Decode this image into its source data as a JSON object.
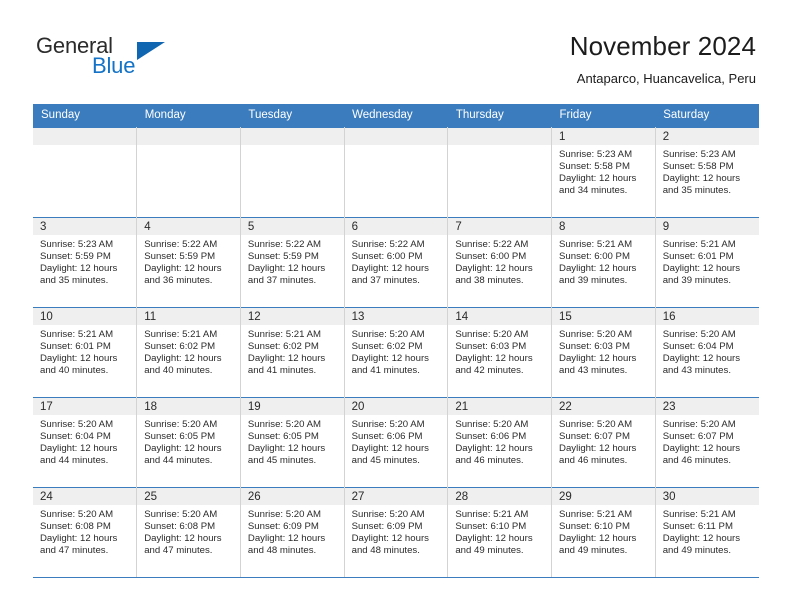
{
  "brand": {
    "name_part1": "General",
    "name_part2": "Blue",
    "colors": {
      "accent": "#1473c6",
      "triangle": "#1066b0",
      "header_blue": "#3a7cbe",
      "daynum_band": "#efefef"
    }
  },
  "header": {
    "title": "November 2024",
    "subtitle": "Antaparco, Huancavelica, Peru"
  },
  "weekdays": [
    "Sunday",
    "Monday",
    "Tuesday",
    "Wednesday",
    "Thursday",
    "Friday",
    "Saturday"
  ],
  "labels": {
    "sunrise_prefix": "Sunrise:",
    "sunset_prefix": "Sunset:",
    "daylight_prefix": "Daylight:"
  },
  "weeks": [
    [
      {
        "day": "",
        "empty": true
      },
      {
        "day": "",
        "empty": true
      },
      {
        "day": "",
        "empty": true
      },
      {
        "day": "",
        "empty": true
      },
      {
        "day": "",
        "empty": true
      },
      {
        "day": "1",
        "sunrise": "Sunrise: 5:23 AM",
        "sunset": "Sunset: 5:58 PM",
        "daylight_l1": "Daylight: 12 hours",
        "daylight_l2": "and 34 minutes."
      },
      {
        "day": "2",
        "sunrise": "Sunrise: 5:23 AM",
        "sunset": "Sunset: 5:58 PM",
        "daylight_l1": "Daylight: 12 hours",
        "daylight_l2": "and 35 minutes."
      }
    ],
    [
      {
        "day": "3",
        "sunrise": "Sunrise: 5:23 AM",
        "sunset": "Sunset: 5:59 PM",
        "daylight_l1": "Daylight: 12 hours",
        "daylight_l2": "and 35 minutes."
      },
      {
        "day": "4",
        "sunrise": "Sunrise: 5:22 AM",
        "sunset": "Sunset: 5:59 PM",
        "daylight_l1": "Daylight: 12 hours",
        "daylight_l2": "and 36 minutes."
      },
      {
        "day": "5",
        "sunrise": "Sunrise: 5:22 AM",
        "sunset": "Sunset: 5:59 PM",
        "daylight_l1": "Daylight: 12 hours",
        "daylight_l2": "and 37 minutes."
      },
      {
        "day": "6",
        "sunrise": "Sunrise: 5:22 AM",
        "sunset": "Sunset: 6:00 PM",
        "daylight_l1": "Daylight: 12 hours",
        "daylight_l2": "and 37 minutes."
      },
      {
        "day": "7",
        "sunrise": "Sunrise: 5:22 AM",
        "sunset": "Sunset: 6:00 PM",
        "daylight_l1": "Daylight: 12 hours",
        "daylight_l2": "and 38 minutes."
      },
      {
        "day": "8",
        "sunrise": "Sunrise: 5:21 AM",
        "sunset": "Sunset: 6:00 PM",
        "daylight_l1": "Daylight: 12 hours",
        "daylight_l2": "and 39 minutes."
      },
      {
        "day": "9",
        "sunrise": "Sunrise: 5:21 AM",
        "sunset": "Sunset: 6:01 PM",
        "daylight_l1": "Daylight: 12 hours",
        "daylight_l2": "and 39 minutes."
      }
    ],
    [
      {
        "day": "10",
        "sunrise": "Sunrise: 5:21 AM",
        "sunset": "Sunset: 6:01 PM",
        "daylight_l1": "Daylight: 12 hours",
        "daylight_l2": "and 40 minutes."
      },
      {
        "day": "11",
        "sunrise": "Sunrise: 5:21 AM",
        "sunset": "Sunset: 6:02 PM",
        "daylight_l1": "Daylight: 12 hours",
        "daylight_l2": "and 40 minutes."
      },
      {
        "day": "12",
        "sunrise": "Sunrise: 5:21 AM",
        "sunset": "Sunset: 6:02 PM",
        "daylight_l1": "Daylight: 12 hours",
        "daylight_l2": "and 41 minutes."
      },
      {
        "day": "13",
        "sunrise": "Sunrise: 5:20 AM",
        "sunset": "Sunset: 6:02 PM",
        "daylight_l1": "Daylight: 12 hours",
        "daylight_l2": "and 41 minutes."
      },
      {
        "day": "14",
        "sunrise": "Sunrise: 5:20 AM",
        "sunset": "Sunset: 6:03 PM",
        "daylight_l1": "Daylight: 12 hours",
        "daylight_l2": "and 42 minutes."
      },
      {
        "day": "15",
        "sunrise": "Sunrise: 5:20 AM",
        "sunset": "Sunset: 6:03 PM",
        "daylight_l1": "Daylight: 12 hours",
        "daylight_l2": "and 43 minutes."
      },
      {
        "day": "16",
        "sunrise": "Sunrise: 5:20 AM",
        "sunset": "Sunset: 6:04 PM",
        "daylight_l1": "Daylight: 12 hours",
        "daylight_l2": "and 43 minutes."
      }
    ],
    [
      {
        "day": "17",
        "sunrise": "Sunrise: 5:20 AM",
        "sunset": "Sunset: 6:04 PM",
        "daylight_l1": "Daylight: 12 hours",
        "daylight_l2": "and 44 minutes."
      },
      {
        "day": "18",
        "sunrise": "Sunrise: 5:20 AM",
        "sunset": "Sunset: 6:05 PM",
        "daylight_l1": "Daylight: 12 hours",
        "daylight_l2": "and 44 minutes."
      },
      {
        "day": "19",
        "sunrise": "Sunrise: 5:20 AM",
        "sunset": "Sunset: 6:05 PM",
        "daylight_l1": "Daylight: 12 hours",
        "daylight_l2": "and 45 minutes."
      },
      {
        "day": "20",
        "sunrise": "Sunrise: 5:20 AM",
        "sunset": "Sunset: 6:06 PM",
        "daylight_l1": "Daylight: 12 hours",
        "daylight_l2": "and 45 minutes."
      },
      {
        "day": "21",
        "sunrise": "Sunrise: 5:20 AM",
        "sunset": "Sunset: 6:06 PM",
        "daylight_l1": "Daylight: 12 hours",
        "daylight_l2": "and 46 minutes."
      },
      {
        "day": "22",
        "sunrise": "Sunrise: 5:20 AM",
        "sunset": "Sunset: 6:07 PM",
        "daylight_l1": "Daylight: 12 hours",
        "daylight_l2": "and 46 minutes."
      },
      {
        "day": "23",
        "sunrise": "Sunrise: 5:20 AM",
        "sunset": "Sunset: 6:07 PM",
        "daylight_l1": "Daylight: 12 hours",
        "daylight_l2": "and 46 minutes."
      }
    ],
    [
      {
        "day": "24",
        "sunrise": "Sunrise: 5:20 AM",
        "sunset": "Sunset: 6:08 PM",
        "daylight_l1": "Daylight: 12 hours",
        "daylight_l2": "and 47 minutes."
      },
      {
        "day": "25",
        "sunrise": "Sunrise: 5:20 AM",
        "sunset": "Sunset: 6:08 PM",
        "daylight_l1": "Daylight: 12 hours",
        "daylight_l2": "and 47 minutes."
      },
      {
        "day": "26",
        "sunrise": "Sunrise: 5:20 AM",
        "sunset": "Sunset: 6:09 PM",
        "daylight_l1": "Daylight: 12 hours",
        "daylight_l2": "and 48 minutes."
      },
      {
        "day": "27",
        "sunrise": "Sunrise: 5:20 AM",
        "sunset": "Sunset: 6:09 PM",
        "daylight_l1": "Daylight: 12 hours",
        "daylight_l2": "and 48 minutes."
      },
      {
        "day": "28",
        "sunrise": "Sunrise: 5:21 AM",
        "sunset": "Sunset: 6:10 PM",
        "daylight_l1": "Daylight: 12 hours",
        "daylight_l2": "and 49 minutes."
      },
      {
        "day": "29",
        "sunrise": "Sunrise: 5:21 AM",
        "sunset": "Sunset: 6:10 PM",
        "daylight_l1": "Daylight: 12 hours",
        "daylight_l2": "and 49 minutes."
      },
      {
        "day": "30",
        "sunrise": "Sunrise: 5:21 AM",
        "sunset": "Sunset: 6:11 PM",
        "daylight_l1": "Daylight: 12 hours",
        "daylight_l2": "and 49 minutes."
      }
    ]
  ]
}
